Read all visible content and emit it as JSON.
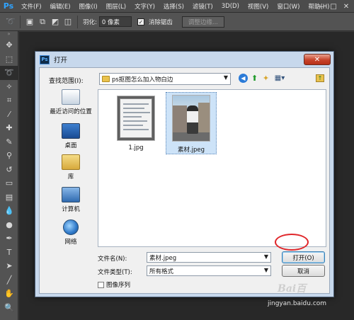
{
  "app": {
    "logo": "Ps"
  },
  "menubar": {
    "items": [
      "文件(F)",
      "编辑(E)",
      "图像(I)",
      "图层(L)",
      "文字(Y)",
      "选择(S)",
      "滤镜(T)",
      "3D(D)",
      "视图(V)",
      "窗口(W)",
      "帮助(H)"
    ],
    "minimize": "—",
    "maximize": "□",
    "close": "✕"
  },
  "options_bar": {
    "feather_label": "羽化:",
    "feather_value": "0 像素",
    "antialias_checked": true,
    "antialias_label": "消除锯齿",
    "refine_edge_label": "调整边缘..."
  },
  "dialog": {
    "title": "打开",
    "close_glyph": "✕",
    "look_in_label": "查找范围(I):",
    "look_in_value": "ps抠图怎么加入物白边",
    "places": [
      {
        "label": "最近访问的位置",
        "icon": "recent-places-icon"
      },
      {
        "label": "桌面",
        "icon": "desktop-icon"
      },
      {
        "label": "库",
        "icon": "library-icon"
      },
      {
        "label": "计算机",
        "icon": "computer-icon"
      },
      {
        "label": "网络",
        "icon": "network-icon"
      }
    ],
    "files": [
      {
        "name": "1.jpg",
        "selected": false
      },
      {
        "name": "素材.jpeg",
        "selected": true
      }
    ],
    "file_name_label": "文件名(N):",
    "file_name_value": "素材.jpeg",
    "file_type_label": "文件类型(T):",
    "file_type_value": "所有格式",
    "open_button": "打开(O)",
    "cancel_button": "取消",
    "image_sequence_label": "图像序列",
    "image_sequence_checked": false,
    "highlight_color": "#e0262a"
  },
  "watermark": {
    "logo": "Bai百",
    "text": "jingyan.baidu.com"
  }
}
